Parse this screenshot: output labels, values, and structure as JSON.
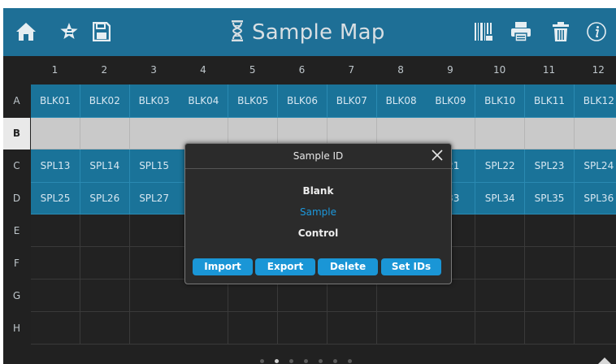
{
  "topbar": {
    "title": "Sample Map",
    "icons": [
      "home-icon",
      "star-icon",
      "save-icon",
      "dna-icon",
      "barcode-icon",
      "print-icon",
      "trash-icon",
      "info-icon"
    ]
  },
  "grid": {
    "columns": [
      "1",
      "2",
      "3",
      "4",
      "5",
      "6",
      "7",
      "8",
      "9",
      "10",
      "11",
      "12"
    ],
    "rows": [
      {
        "label": "A",
        "style": "blue",
        "cells": [
          "BLK01",
          "BLK02",
          "BLK03",
          "BLK04",
          "BLK05",
          "BLK06",
          "BLK07",
          "BLK08",
          "BLK09",
          "BLK10",
          "BLK11",
          "BLK12"
        ]
      },
      {
        "label": "B",
        "style": "gray",
        "selected": true,
        "cells": [
          "",
          "",
          "",
          "",
          "",
          "",
          "",
          "",
          "",
          "",
          "",
          ""
        ]
      },
      {
        "label": "C",
        "style": "blue",
        "cells": [
          "SPL13",
          "SPL14",
          "SPL15",
          "",
          "",
          "",
          "",
          "",
          "L21",
          "SPL22",
          "SPL23",
          "SPL24"
        ]
      },
      {
        "label": "D",
        "style": "blue",
        "cells": [
          "SPL25",
          "SPL26",
          "SPL27",
          "",
          "",
          "",
          "",
          "",
          "L33",
          "SPL34",
          "SPL35",
          "SPL36"
        ]
      },
      {
        "label": "E",
        "style": "dark",
        "cells": [
          "",
          "",
          "",
          "",
          "",
          "",
          "",
          "",
          "",
          "",
          "",
          ""
        ]
      },
      {
        "label": "F",
        "style": "dark",
        "cells": [
          "",
          "",
          "",
          "",
          "",
          "",
          "",
          "",
          "",
          "",
          "",
          ""
        ]
      },
      {
        "label": "G",
        "style": "dark",
        "cells": [
          "",
          "",
          "",
          "",
          "",
          "",
          "",
          "",
          "",
          "",
          "",
          ""
        ]
      },
      {
        "label": "H",
        "style": "dark",
        "cells": [
          "",
          "",
          "",
          "",
          "",
          "",
          "",
          "",
          "",
          "",
          "",
          ""
        ]
      }
    ]
  },
  "pager": {
    "count": 7,
    "active": 1
  },
  "dialog": {
    "title": "Sample ID",
    "options": [
      {
        "label": "Blank",
        "selected": false
      },
      {
        "label": "Sample",
        "selected": true
      },
      {
        "label": "Control",
        "selected": false
      }
    ],
    "buttons": {
      "import": "Import",
      "export": "Export",
      "delete": "Delete",
      "set_ids": "Set IDs"
    }
  },
  "colors": {
    "topbar": "#1e6f96",
    "cell_blue": "#1a7399",
    "cell_gray": "#c9c9c9",
    "background": "#212121",
    "dialog_button": "#1a96d6",
    "selected_option": "#1c99dd"
  }
}
